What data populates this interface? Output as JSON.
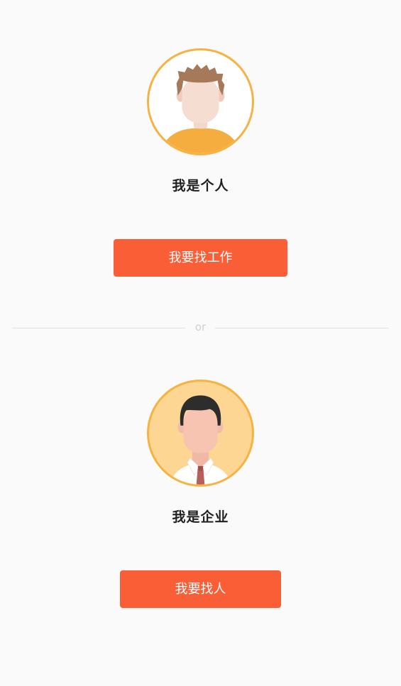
{
  "personal": {
    "avatar_icon": "young-man-avatar-icon",
    "title": "我是个人",
    "button_label": "我要找工作"
  },
  "divider": {
    "text": "or"
  },
  "company": {
    "avatar_icon": "businessman-avatar-icon",
    "title": "我是企业",
    "button_label": "我要找人"
  },
  "colors": {
    "accent": "#f95e37",
    "avatar_ring": "#f6b343",
    "company_avatar_bg": "#fed693",
    "background": "#fafafa"
  }
}
